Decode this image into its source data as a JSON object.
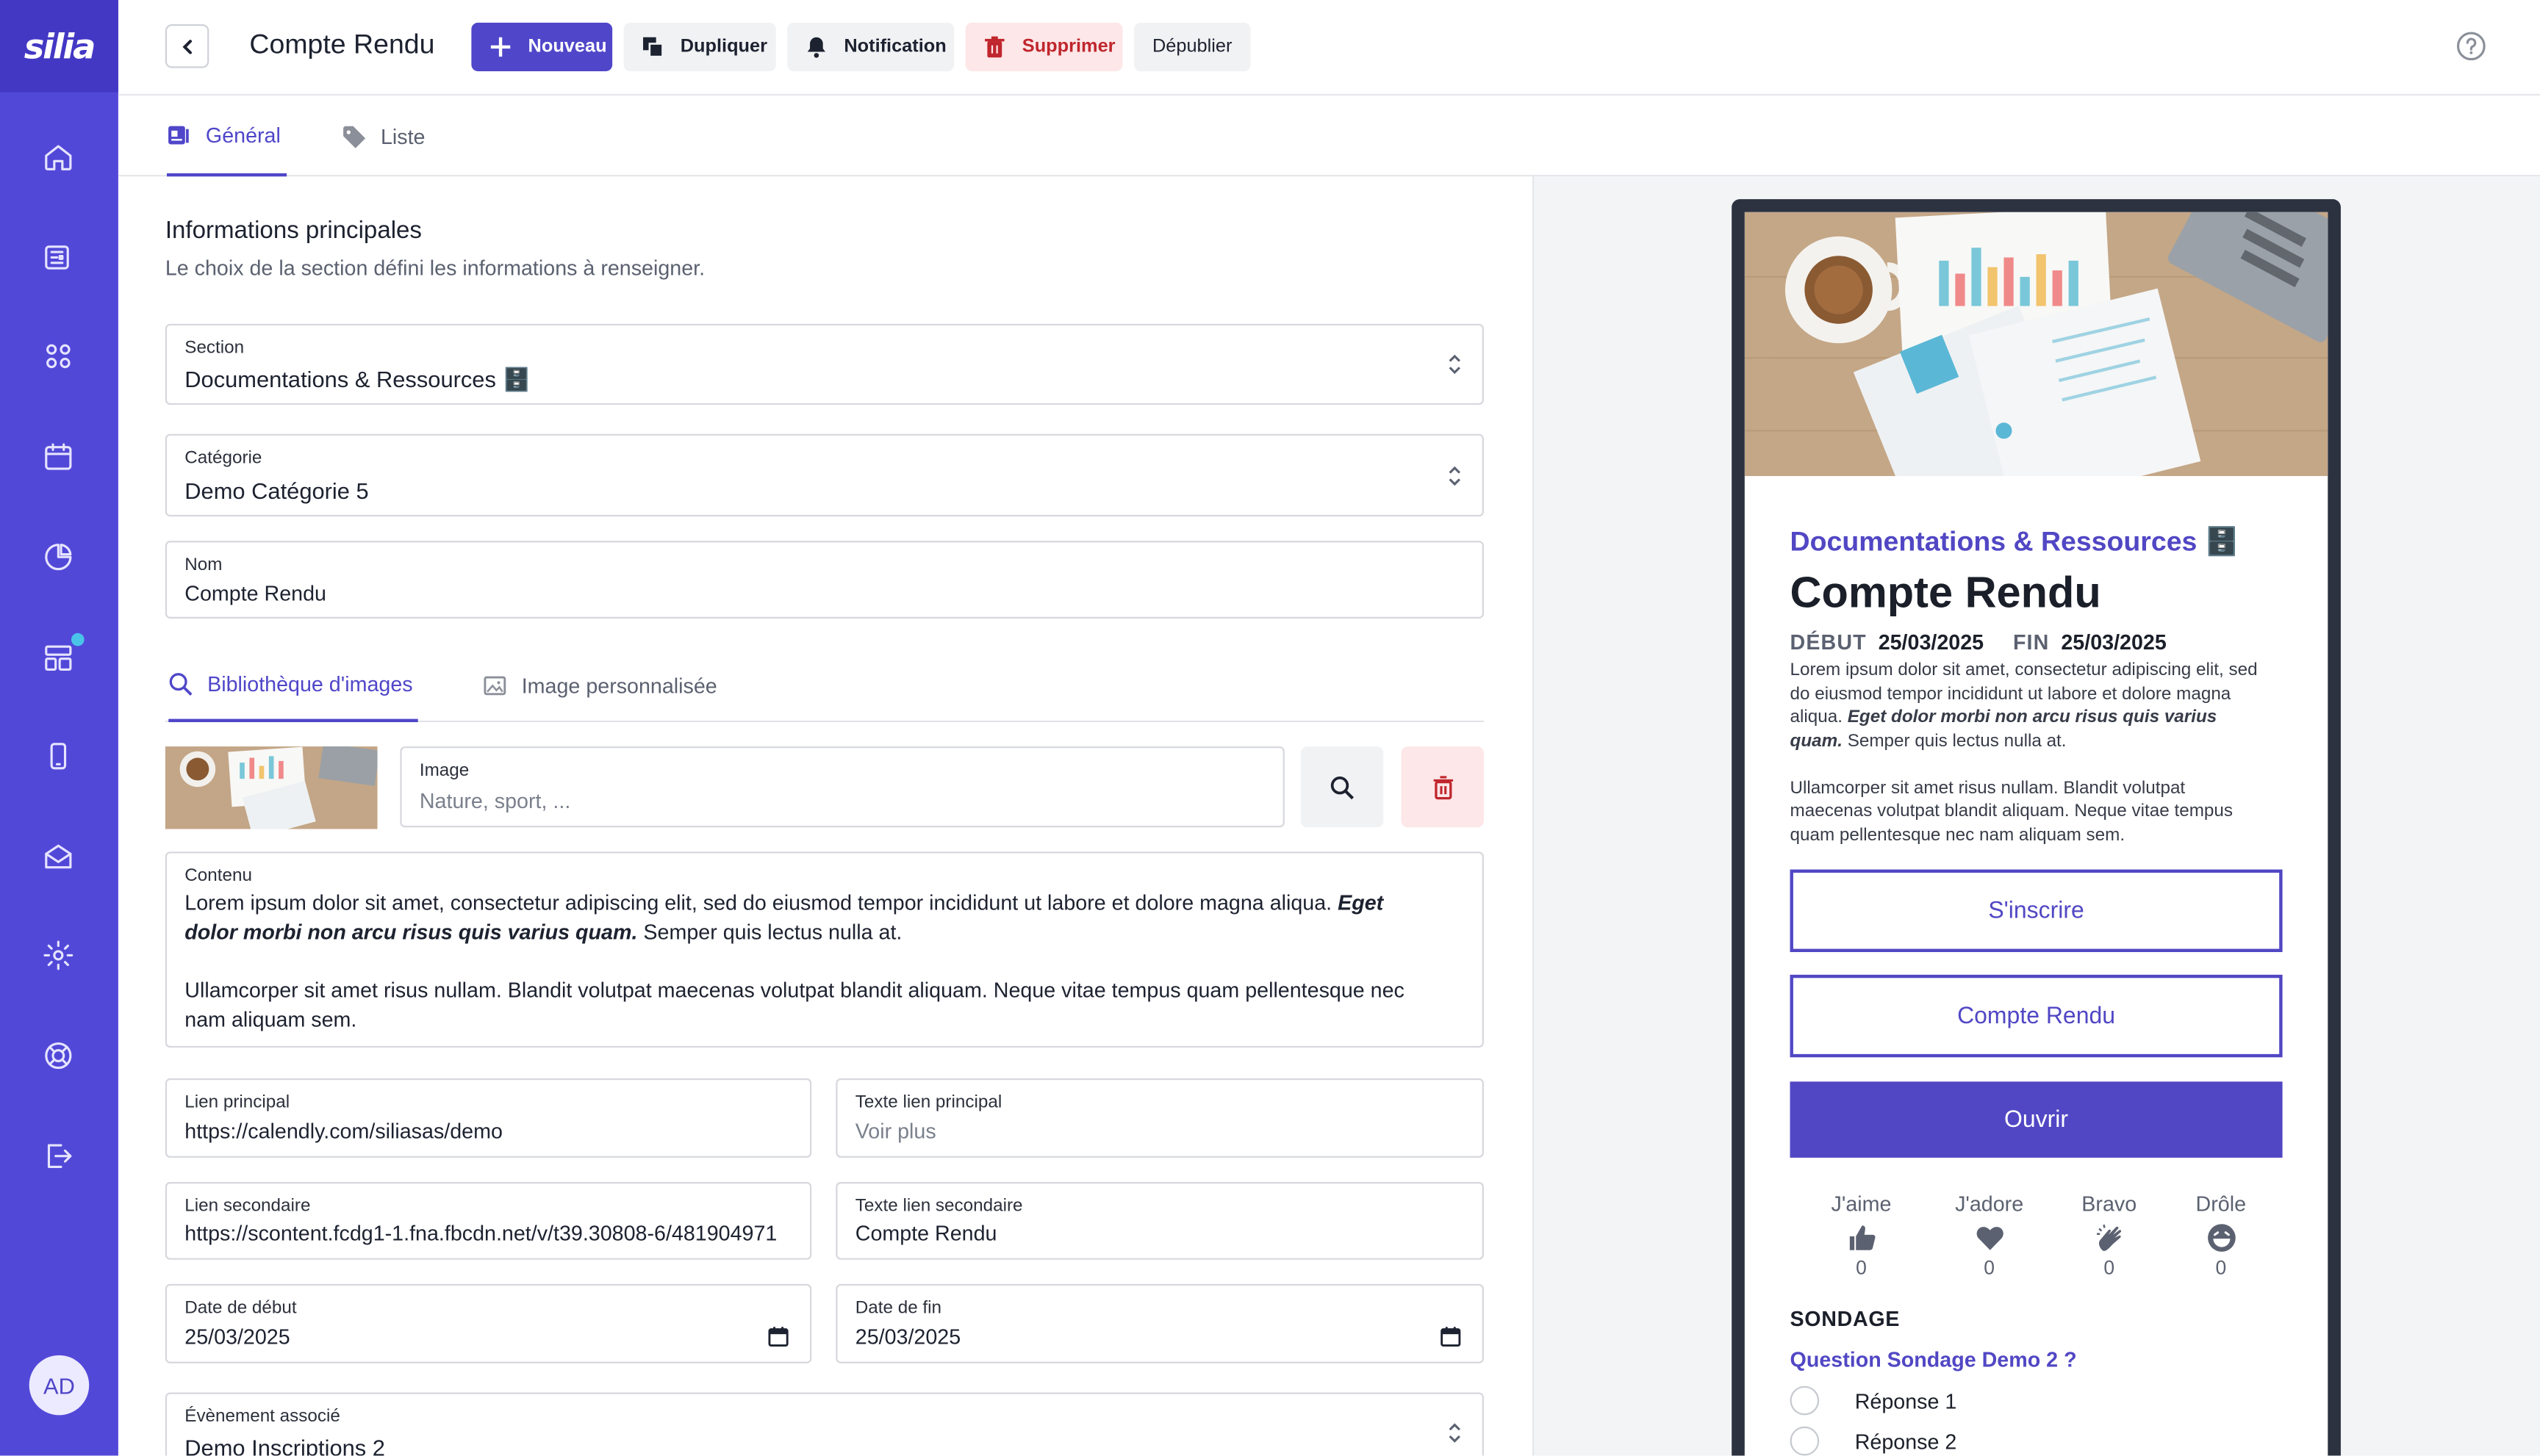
{
  "sidebar": {
    "logo": "silia",
    "items": [
      {
        "icon": "home-icon"
      },
      {
        "icon": "news-icon"
      },
      {
        "icon": "apps-icon"
      },
      {
        "icon": "calendar-icon"
      },
      {
        "icon": "pie-chart-icon"
      },
      {
        "icon": "layout-icon"
      },
      {
        "icon": "mobile-icon"
      },
      {
        "icon": "mail-icon"
      },
      {
        "icon": "gear-icon"
      },
      {
        "icon": "lifebuoy-icon"
      },
      {
        "icon": "logout-icon"
      }
    ],
    "avatar": "AD"
  },
  "header": {
    "title": "Compte Rendu",
    "buttons": {
      "new": "Nouveau",
      "duplicate": "Dupliquer",
      "notification": "Notification",
      "delete": "Supprimer",
      "unpublish": "Dépublier"
    }
  },
  "tabs": {
    "general": "Général",
    "list": "Liste"
  },
  "form": {
    "section_title": "Informations principales",
    "section_subtitle": "Le choix de la section défini les informations à renseigner.",
    "section": {
      "label": "Section",
      "value": "Documentations & Ressources 🗄️"
    },
    "category": {
      "label": "Catégorie",
      "value": "Demo Catégorie 5"
    },
    "name": {
      "label": "Nom",
      "value": "Compte Rendu"
    },
    "image_tabs": {
      "library": "Bibliothèque d'images",
      "custom": "Image personnalisée"
    },
    "image": {
      "label": "Image",
      "placeholder": "Nature, sport, ..."
    },
    "content": {
      "label": "Contenu",
      "p1_text": "Lorem ipsum dolor sit amet, consectetur adipiscing elit, sed do eiusmod tempor incididunt ut labore et dolore magna aliqua. ",
      "p1_bold": "Eget dolor morbi non arcu risus quis varius quam.",
      "p1_end": " Semper quis lectus nulla at.",
      "p2": "Ullamcorper sit amet risus nullam. Blandit volutpat maecenas volutpat blandit aliquam. Neque vitae tempus quam pellentesque nec nam aliquam sem."
    },
    "main_link": {
      "label": "Lien principal",
      "value": "https://calendly.com/siliasas/demo"
    },
    "main_link_text": {
      "label": "Texte lien principal",
      "placeholder": "Voir plus"
    },
    "secondary_link": {
      "label": "Lien secondaire",
      "value": "https://scontent.fcdg1-1.fna.fbcdn.net/v/t39.30808-6/481904971"
    },
    "secondary_link_text": {
      "label": "Texte lien secondaire",
      "value": "Compte Rendu"
    },
    "start_date": {
      "label": "Date de début",
      "value": "25/03/2025"
    },
    "end_date": {
      "label": "Date de fin",
      "value": "25/03/2025"
    },
    "event": {
      "label": "Évènement associé",
      "value": "Demo Inscriptions 2"
    }
  },
  "preview": {
    "section": "Documentations & Ressources 🗄️",
    "title": "Compte Rendu",
    "start_label": "DÉBUT",
    "start_value": "25/03/2025",
    "end_label": "FIN",
    "end_value": "25/03/2025",
    "p1_text": "Lorem ipsum dolor sit amet, consectetur adipiscing elit, sed do eiusmod tempor incididunt ut labore et dolore magna aliqua. ",
    "p1_bold": "Eget dolor morbi non arcu risus quis varius quam.",
    "p1_end": " Semper quis lectus nulla at.",
    "p2": "Ullamcorper sit amet risus nullam. Blandit volutpat maecenas volutpat blandit aliquam. Neque vitae tempus quam pellentesque nec nam aliquam sem.",
    "btn_register": "S'inscrire",
    "btn_secondary": "Compte Rendu",
    "btn_open": "Ouvrir",
    "reactions": [
      {
        "label": "J'aime",
        "count": "0",
        "icon": "thumbs-up-icon"
      },
      {
        "label": "J'adore",
        "count": "0",
        "icon": "heart-icon"
      },
      {
        "label": "Bravo",
        "count": "0",
        "icon": "clap-icon"
      },
      {
        "label": "Drôle",
        "count": "0",
        "icon": "laugh-icon"
      }
    ],
    "survey_title": "SONDAGE",
    "survey_question": "Question Sondage Demo 2 ?",
    "answers": [
      "Réponse 1",
      "Réponse 2"
    ]
  },
  "colors": {
    "accent": "#5248d8",
    "danger": "#c0262d",
    "danger_bg": "#fde7e8"
  }
}
